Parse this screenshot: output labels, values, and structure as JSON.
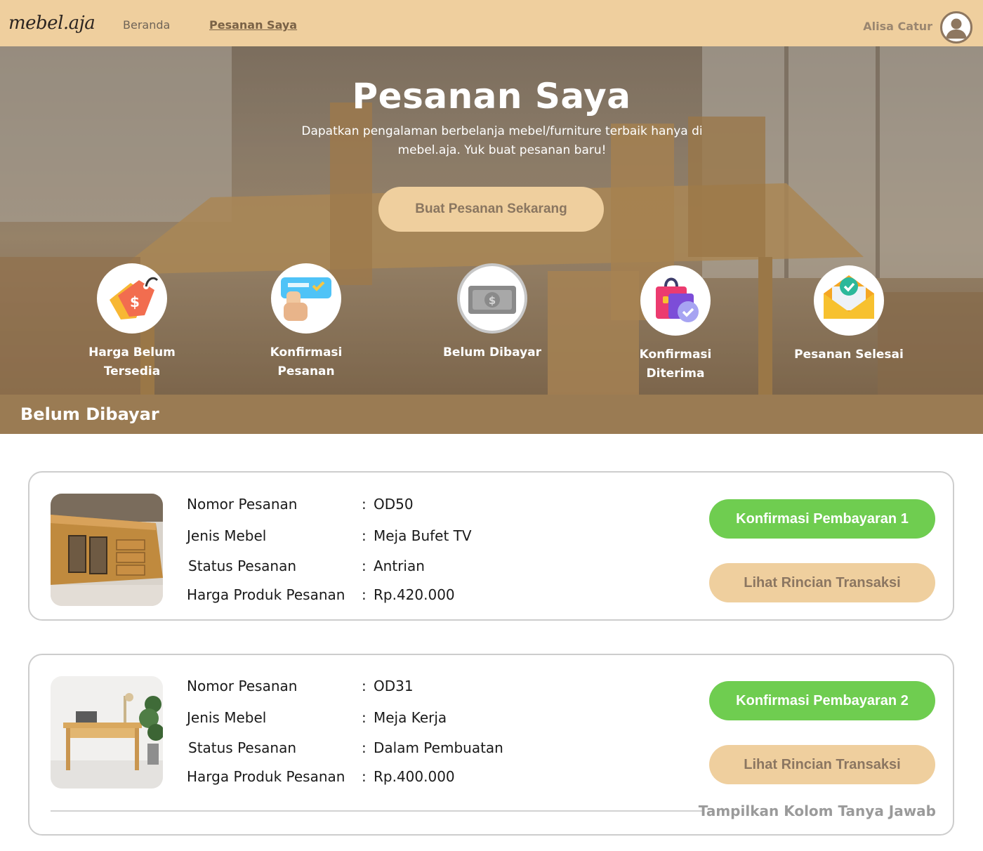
{
  "navbar": {
    "logo": "mebel.aja",
    "links": [
      "Beranda",
      "Pesanan Saya"
    ],
    "user_name": "Alisa Catur",
    "avatar_icon": "user-avatar-icon"
  },
  "hero": {
    "title": "Pesanan Saya",
    "subtitle": "Dapatkan pengalaman berbelanja mebel/furniture terbaik hanya di mebel.aja. Yuk buat pesanan baru!",
    "cta_label": "Buat Pesanan Sekarang",
    "steps": [
      {
        "label": "Harga Belum Tersedia",
        "icon": "price-tag-icon"
      },
      {
        "label": "Konfirmasi Pesanan",
        "icon": "hand-card-icon"
      },
      {
        "label": "Belum Dibayar",
        "icon": "cash-icon",
        "active": true
      },
      {
        "label": "Konfirmasi Diterima",
        "icon": "shopping-bag-check-icon"
      },
      {
        "label": "Pesanan Selesai",
        "icon": "envelope-check-icon"
      }
    ]
  },
  "section": {
    "title": "Belum Dibayar"
  },
  "field_labels": {
    "order_number": "Nomor Pesanan",
    "furniture_type": "Jenis Mebel",
    "order_status": "Status Pesanan",
    "product_price": "Harga Produk Pesanan",
    "colon": ":"
  },
  "orders": [
    {
      "order_number": "OD50",
      "furniture_type": "Meja Bufet TV",
      "status": "Antrian",
      "price": "Rp.420.000",
      "confirm_label": "Konfirmasi Pembayaran 1",
      "details_label": "Lihat Rincian Transaksi"
    },
    {
      "order_number": "OD31",
      "furniture_type": "Meja Kerja",
      "status": "Dalam Pembuatan",
      "price": "Rp.400.000",
      "confirm_label": "Konfirmasi Pembayaran 2",
      "details_label": "Lihat Rincian Transaksi",
      "qa_label": "Tampilkan Kolom Tanya Jawab"
    }
  ],
  "colors": {
    "navbar": "#efcf9e",
    "section_bar": "#9a7b53",
    "confirm_button": "#6fcd50",
    "details_button": "#efcf9e"
  }
}
